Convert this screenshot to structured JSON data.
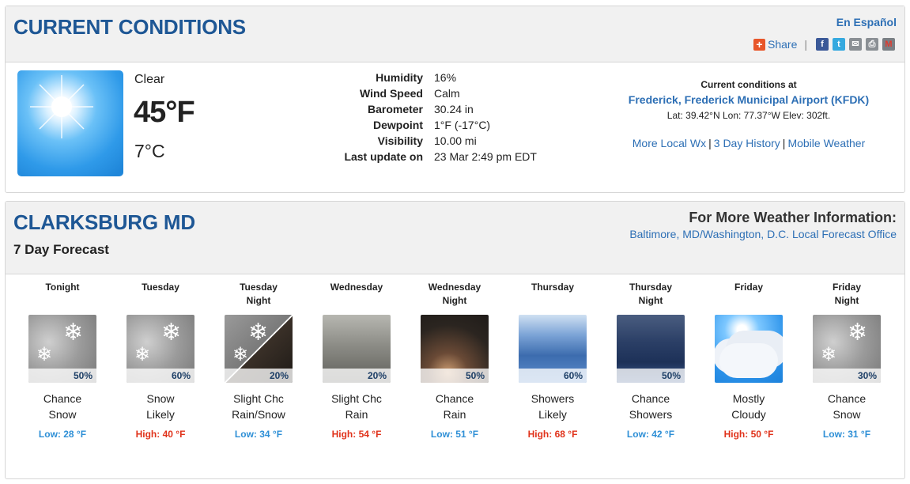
{
  "current": {
    "title": "CURRENT CONDITIONS",
    "espanol": "En Español",
    "share_label": "Share",
    "share_separator": "|",
    "social_icons": [
      "facebook-icon",
      "twitter-icon",
      "email-icon",
      "print-icon",
      "gmail-icon"
    ],
    "condition": "Clear",
    "temp_f": "45°F",
    "temp_c": "7°C",
    "details": [
      {
        "label": "Humidity",
        "value": "16%"
      },
      {
        "label": "Wind Speed",
        "value": "Calm"
      },
      {
        "label": "Barometer",
        "value": "30.24 in"
      },
      {
        "label": "Dewpoint",
        "value": "1°F (-17°C)"
      },
      {
        "label": "Visibility",
        "value": "10.00 mi"
      },
      {
        "label": "Last update on",
        "value": "23 Mar 2:49 pm EDT"
      }
    ],
    "station": {
      "heading": "Current conditions at",
      "name": "Frederick, Frederick Municipal Airport (KFDK)",
      "coords": "Lat: 39.42°N Lon: 77.37°W Elev: 302ft.",
      "links": [
        "More Local Wx",
        "3 Day History",
        "Mobile Weather"
      ],
      "link_separator": "|"
    }
  },
  "forecast": {
    "location": "CLARKSBURG MD",
    "subtitle": "7 Day Forecast",
    "more_info": "For More Weather Information:",
    "office_link": "Baltimore, MD/Washington, D.C. Local Forecast Office",
    "days": [
      {
        "name_1": "Tonight",
        "name_2": "",
        "pop": "50%",
        "short_1": "Chance",
        "short_2": "Snow",
        "temp": "Low: 28 °F",
        "kind": "low",
        "icon": "snow-icon"
      },
      {
        "name_1": "Tuesday",
        "name_2": "",
        "pop": "60%",
        "short_1": "Snow",
        "short_2": "Likely",
        "temp": "High: 40 °F",
        "kind": "high",
        "icon": "snow-icon"
      },
      {
        "name_1": "Tuesday",
        "name_2": "Night",
        "pop": "20%",
        "short_1": "Slight Chc",
        "short_2": "Rain/Snow",
        "temp": "Low: 34 °F",
        "kind": "low",
        "icon": "rain-snow-icon"
      },
      {
        "name_1": "Wednesday",
        "name_2": "",
        "pop": "20%",
        "short_1": "Slight Chc",
        "short_2": "Rain",
        "temp": "High: 54 °F",
        "kind": "high",
        "icon": "rain-day-icon"
      },
      {
        "name_1": "Wednesday",
        "name_2": "Night",
        "pop": "50%",
        "short_1": "Chance",
        "short_2": "Rain",
        "temp": "Low: 51 °F",
        "kind": "low",
        "icon": "rain-night-icon"
      },
      {
        "name_1": "Thursday",
        "name_2": "",
        "pop": "60%",
        "short_1": "Showers",
        "short_2": "Likely",
        "temp": "High: 68 °F",
        "kind": "high",
        "icon": "showers-day-icon"
      },
      {
        "name_1": "Thursday",
        "name_2": "Night",
        "pop": "50%",
        "short_1": "Chance",
        "short_2": "Showers",
        "temp": "Low: 42 °F",
        "kind": "low",
        "icon": "showers-night-icon"
      },
      {
        "name_1": "Friday",
        "name_2": "",
        "pop": "",
        "short_1": "Mostly",
        "short_2": "Cloudy",
        "temp": "High: 50 °F",
        "kind": "high",
        "icon": "mostly-cloudy-icon"
      },
      {
        "name_1": "Friday",
        "name_2": "Night",
        "pop": "30%",
        "short_1": "Chance",
        "short_2": "Snow",
        "temp": "Low: 31 °F",
        "kind": "low",
        "icon": "snow-icon"
      }
    ]
  },
  "colors": {
    "title_blue": "#1e5795",
    "link_blue": "#2d6fb5",
    "low_blue": "#2e8fd6",
    "high_red": "#e0321a"
  }
}
